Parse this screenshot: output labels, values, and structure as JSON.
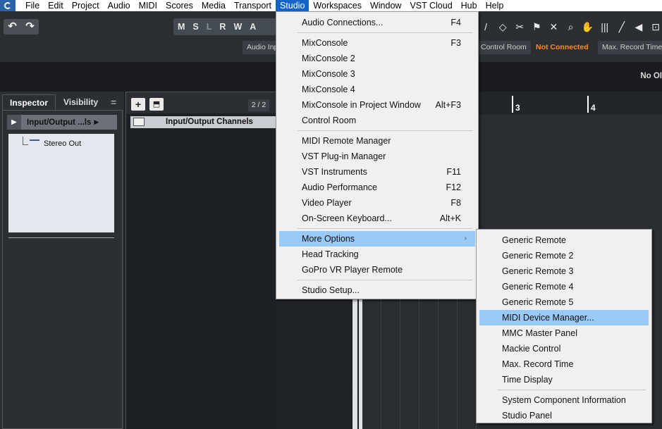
{
  "menubar": {
    "items": [
      "File",
      "Edit",
      "Project",
      "Audio",
      "MIDI",
      "Scores",
      "Media",
      "Transport",
      "Studio",
      "Workspaces",
      "Window",
      "VST Cloud",
      "Hub",
      "Help"
    ],
    "active": "Studio"
  },
  "toolbar": {
    "undo_icon": "↶",
    "redo_icon": "↷",
    "mslrw": [
      "M",
      "S",
      "L",
      "R",
      "W",
      "A"
    ],
    "tool_icons": [
      "/",
      "◇",
      "✂",
      "⚑",
      "✕",
      "⌕",
      "✋",
      "|||",
      "╱",
      "◀",
      "⊡"
    ],
    "audio_input_label": "Audio Inp",
    "control_room_label": "Control Room",
    "connection_status": "Not Connected",
    "max_record_label": "Max. Record Time",
    "status_color": "#ff8a1f"
  },
  "infostrip": {
    "right_text": "No OI"
  },
  "inspector": {
    "tabs": [
      "Inspector",
      "Visibility"
    ],
    "menu_icon": "=",
    "header_title": "Input/Output ...ls",
    "play_icon": "▶",
    "arrow_icon": "▶",
    "tree_item": "Stereo Out"
  },
  "tracklist": {
    "add_icon": "+",
    "folder_icon": "⬒",
    "count": "2 / 2",
    "track_name": "Input/Output Channels"
  },
  "ruler": {
    "markers": [
      "3",
      "4"
    ]
  },
  "studio_menu": {
    "groups": [
      [
        {
          "label": "Audio Connections...",
          "shortcut": "F4"
        }
      ],
      [
        {
          "label": "MixConsole",
          "shortcut": "F3"
        },
        {
          "label": "MixConsole 2",
          "shortcut": ""
        },
        {
          "label": "MixConsole 3",
          "shortcut": ""
        },
        {
          "label": "MixConsole 4",
          "shortcut": ""
        },
        {
          "label": "MixConsole in Project Window",
          "shortcut": "Alt+F3"
        },
        {
          "label": "Control Room",
          "shortcut": ""
        }
      ],
      [
        {
          "label": "MIDI Remote Manager",
          "shortcut": ""
        },
        {
          "label": "VST Plug-in Manager",
          "shortcut": ""
        },
        {
          "label": "VST Instruments",
          "shortcut": "F11"
        },
        {
          "label": "Audio Performance",
          "shortcut": "F12"
        },
        {
          "label": "Video Player",
          "shortcut": "F8"
        },
        {
          "label": "On-Screen Keyboard...",
          "shortcut": "Alt+K"
        }
      ],
      [
        {
          "label": "More Options",
          "shortcut": "",
          "submenu": true,
          "highlighted": true
        },
        {
          "label": "Head Tracking",
          "shortcut": ""
        },
        {
          "label": "GoPro VR Player Remote",
          "shortcut": ""
        }
      ],
      [
        {
          "label": "Studio Setup...",
          "shortcut": ""
        }
      ]
    ],
    "submenu_arrow": "›"
  },
  "more_options_menu": {
    "groups": [
      [
        {
          "label": "Generic Remote"
        },
        {
          "label": "Generic Remote 2"
        },
        {
          "label": "Generic Remote 3"
        },
        {
          "label": "Generic Remote 4"
        },
        {
          "label": "Generic Remote 5"
        },
        {
          "label": "MIDI Device Manager...",
          "highlighted": true
        },
        {
          "label": "MMC Master Panel"
        },
        {
          "label": "Mackie Control"
        },
        {
          "label": "Max. Record Time"
        },
        {
          "label": "Time Display"
        }
      ],
      [
        {
          "label": "System Component Information"
        },
        {
          "label": "Studio Panel"
        }
      ]
    ]
  }
}
